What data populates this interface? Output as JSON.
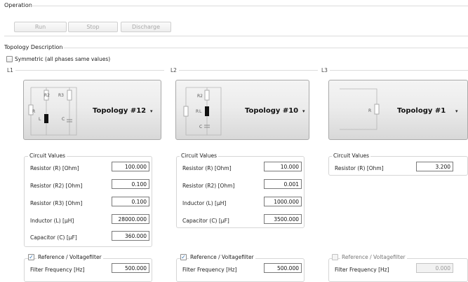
{
  "operation": {
    "title": "Operation",
    "buttons": {
      "run": "Run",
      "stop": "Stop",
      "discharge": "Discharge"
    }
  },
  "topology": {
    "title": "Topology Description",
    "symmetric_label": "Symmetric (all phases same values)",
    "symmetric_checked": false,
    "phases": [
      {
        "label": "L1",
        "topology": "Topology #12",
        "diagram_labels": {
          "r": "R",
          "r2": "R2",
          "r3": "R3",
          "l": "L",
          "c": "C"
        },
        "circuit_values_title": "Circuit Values",
        "rows": [
          {
            "label": "Resistor (R) [Ohm]",
            "value": "100.000"
          },
          {
            "label": "Resistor (R2) [Ohm]",
            "value": "0.100"
          },
          {
            "label": "Resistor (R3) [Ohm]",
            "value": "0.100"
          },
          {
            "label": "Inductor (L) [µH]",
            "value": "28000.000"
          },
          {
            "label": "Capacitor (C) [µF]",
            "value": "360.000"
          }
        ],
        "filter": {
          "label": "Reference / Voltagefilter",
          "checked": true,
          "freq_label": "Filter Frequency [Hz]",
          "freq_value": "500.000"
        }
      },
      {
        "label": "L2",
        "topology": "Topology #10",
        "diagram_labels": {
          "r": "R",
          "r2": "R2",
          "l": "L",
          "c": "C"
        },
        "circuit_values_title": "Circuit Values",
        "rows": [
          {
            "label": "Resistor (R) [Ohm]",
            "value": "10.000"
          },
          {
            "label": "Resistor (R2) [Ohm]",
            "value": "0.001"
          },
          {
            "label": "Inductor (L) [µH]",
            "value": "1000.000"
          },
          {
            "label": "Capacitor (C) [µF]",
            "value": "3500.000"
          }
        ],
        "filter": {
          "label": "Reference / Voltagefilter",
          "checked": true,
          "freq_label": "Filter Frequency [Hz]",
          "freq_value": "500.000"
        }
      },
      {
        "label": "L3",
        "topology": "Topology #1",
        "diagram_labels": {
          "r": "R"
        },
        "circuit_values_title": "Circuit Values",
        "rows": [
          {
            "label": "Resistor (R) [Ohm]",
            "value": "3.200"
          }
        ],
        "filter": {
          "label": "Reference / Voltagefilter",
          "checked": false,
          "freq_label": "Filter Frequency [Hz]",
          "freq_value": "0.000"
        }
      }
    ]
  },
  "icons": {
    "check": "checkmark-icon",
    "dropdown": "caret-down-icon"
  },
  "colors": {
    "checkmark": "#2b6cb0",
    "disabled_text": "#a8a8a8"
  }
}
